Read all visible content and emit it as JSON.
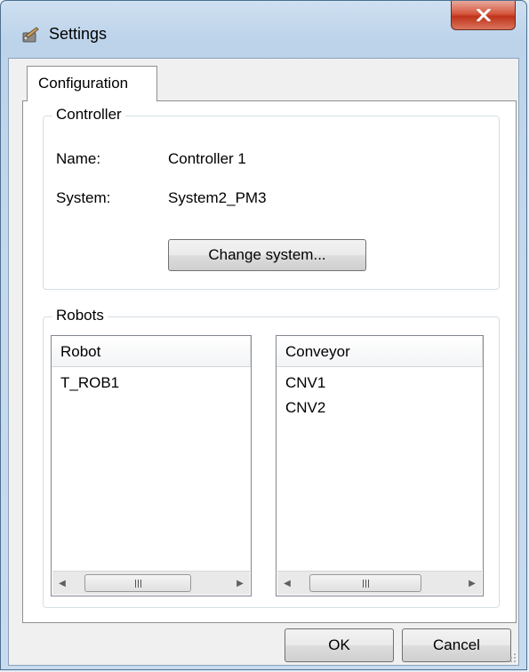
{
  "window": {
    "title": "Settings",
    "icon": "settings-wrench-icon",
    "close_icon": "close-icon"
  },
  "tabs": [
    {
      "label": "Configuration",
      "selected": true
    }
  ],
  "controller": {
    "group_title": "Controller",
    "name_label": "Name:",
    "name_value": "Controller 1",
    "system_label": "System:",
    "system_value": "System2_PM3",
    "change_system_label": "Change system..."
  },
  "robots": {
    "group_title": "Robots",
    "robot_list": {
      "header": "Robot",
      "items": [
        "T_ROB1"
      ],
      "scroll_thumb_glyph": "III"
    },
    "conveyor_list": {
      "header": "Conveyor",
      "items": [
        "CNV1",
        "CNV2"
      ],
      "scroll_thumb_glyph": "III"
    }
  },
  "buttons": {
    "ok_label": "OK",
    "cancel_label": "Cancel"
  },
  "colors": {
    "close_button": "#c7452c",
    "frame": "#c5d9ec",
    "client_bg": "#f0f0f0"
  }
}
